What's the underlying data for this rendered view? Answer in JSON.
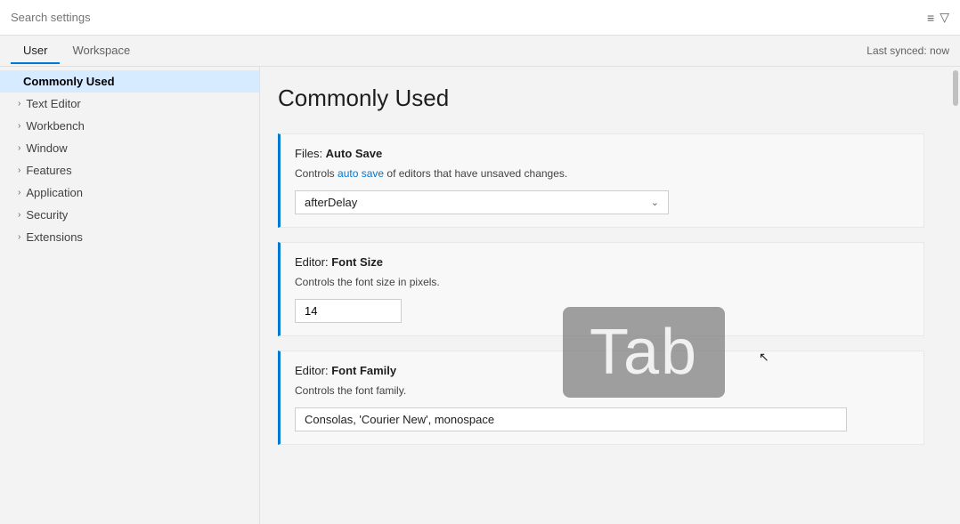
{
  "searchbar": {
    "placeholder": "Search settings",
    "filter_icon": "≡",
    "funnel_icon": "⊿"
  },
  "tabs": {
    "user_label": "User",
    "workspace_label": "Workspace",
    "active": "user",
    "last_synced": "Last synced: now"
  },
  "sidebar": {
    "items": [
      {
        "id": "commonly-used",
        "label": "Commonly Used",
        "active": true,
        "indent": false
      },
      {
        "id": "text-editor",
        "label": "Text Editor",
        "active": false,
        "indent": true
      },
      {
        "id": "workbench",
        "label": "Workbench",
        "active": false,
        "indent": true
      },
      {
        "id": "window",
        "label": "Window",
        "active": false,
        "indent": true
      },
      {
        "id": "features",
        "label": "Features",
        "active": false,
        "indent": true
      },
      {
        "id": "application",
        "label": "Application",
        "active": false,
        "indent": true
      },
      {
        "id": "security",
        "label": "Security",
        "active": false,
        "indent": true
      },
      {
        "id": "extensions",
        "label": "Extensions",
        "active": false,
        "indent": true
      }
    ]
  },
  "content": {
    "title": "Commonly Used",
    "settings": [
      {
        "id": "auto-save",
        "label_prefix": "Files: ",
        "label_bold": "Auto Save",
        "desc_before": "Controls ",
        "desc_link": "auto save",
        "desc_after": " of editors that have unsaved changes.",
        "type": "dropdown",
        "value": "afterDelay"
      },
      {
        "id": "font-size",
        "label_prefix": "Editor: ",
        "label_bold": "Font Size",
        "desc": "Controls the font size in pixels.",
        "type": "number",
        "value": "14"
      },
      {
        "id": "font-family",
        "label_prefix": "Editor: ",
        "label_bold": "Font Family",
        "desc": "Controls the font family.",
        "type": "text",
        "value": "Consolas, 'Courier New', monospace"
      }
    ]
  },
  "tab_overlay": {
    "text": "Tab"
  },
  "icons": {
    "chevron_right": "›",
    "chevron_down": "⌄",
    "lines": "≡",
    "filter": "▽",
    "cursor": "↖"
  }
}
